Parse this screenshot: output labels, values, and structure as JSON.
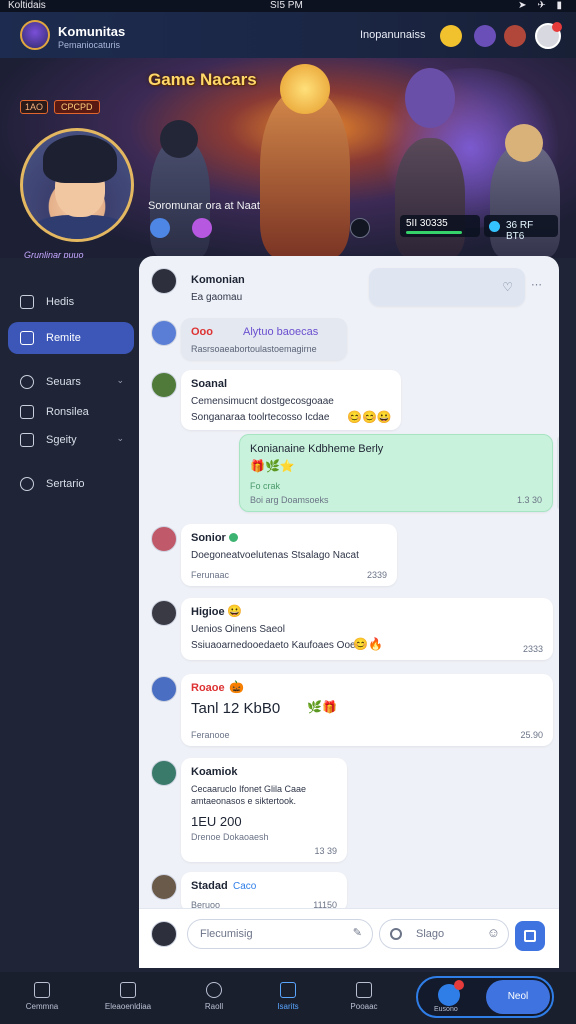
{
  "statusbar": {
    "left": "Koltidais",
    "center": "SI5 PM",
    "right": "➤ ✈ ▮"
  },
  "app": {
    "title": "Komunitas",
    "subtitle": "Pemaniocaturis",
    "user": "Inopanunaiss"
  },
  "hero": {
    "game_title": "Game Nacars",
    "names_line": "Soromunar ora  at  Naat",
    "level": "1AO",
    "level_badge": "CPCPD",
    "stat_left": "5II  30335",
    "stat_right": "36 RF BT6"
  },
  "profile": {
    "label": "Grunlinar puuo"
  },
  "sidebar": {
    "items": [
      {
        "label": "Hedis"
      },
      {
        "label": "Remite"
      },
      {
        "label": "Seuars"
      },
      {
        "label": "Ronsilea"
      },
      {
        "label": "Sgeity"
      },
      {
        "label": "Sertario"
      }
    ]
  },
  "messages": [
    {
      "name": "Komonian",
      "line1": "Ea gaomau",
      "time": ""
    },
    {
      "name": "Ooo",
      "tag": "Alytuo baoecas",
      "line1": "Rasrsoaeabortoulastoemagirne",
      "time": ""
    },
    {
      "name": "Soanal",
      "line1": "Cemensimucnt dostgecosgoaae",
      "line2": "Songanaraa toolrtecosso Icdae",
      "time": ""
    },
    {
      "name": "Konianaine Kdbheme Berly",
      "line1": "Fo crak",
      "meta": "Boi arg Doamsoeks",
      "time": "1.3 30"
    },
    {
      "name": "Sonior",
      "line1": "Doegoneatvoelutenas Stsalago Nacat",
      "meta": "Ferunaac",
      "time": "2339"
    },
    {
      "name": "Higioe",
      "line1": "Uenios Oinens Saeol",
      "line2": "Ssiuaoarnedooedaeto  Kaufoaes Ooe",
      "time": "2333"
    },
    {
      "name": "Roaoe",
      "big": "Tanl  12  KbB0",
      "meta": "Feranooe",
      "time": "25.90"
    },
    {
      "name": "Koamiok",
      "line1": "Cecaaruclo Ifonet Glila  Caae",
      "line2": "amtaeonasos e siktertook.",
      "big": "1EU  200",
      "meta": "Drenoe Dokaoaesh",
      "time": "13 39"
    },
    {
      "name": "Stadad",
      "tag": "Caco",
      "meta": "Beruoo",
      "time": "11150"
    }
  ],
  "composer": {
    "placeholder": "Flecumisig",
    "secondary": "Slago"
  },
  "bottomnav": [
    {
      "label": "Cemmna"
    },
    {
      "label": "Eleaoenldiaa"
    },
    {
      "label": "Raoll"
    },
    {
      "label": "Isarits"
    },
    {
      "label": "Pooaac"
    },
    {
      "label": "Eusono"
    }
  ],
  "fab": {
    "label": "Neol"
  },
  "colors": {
    "accent": "#3f74e0",
    "sidebar": "#1f2536",
    "mine_bubble": "#c9f2dc",
    "status_green": "#36d26a"
  }
}
